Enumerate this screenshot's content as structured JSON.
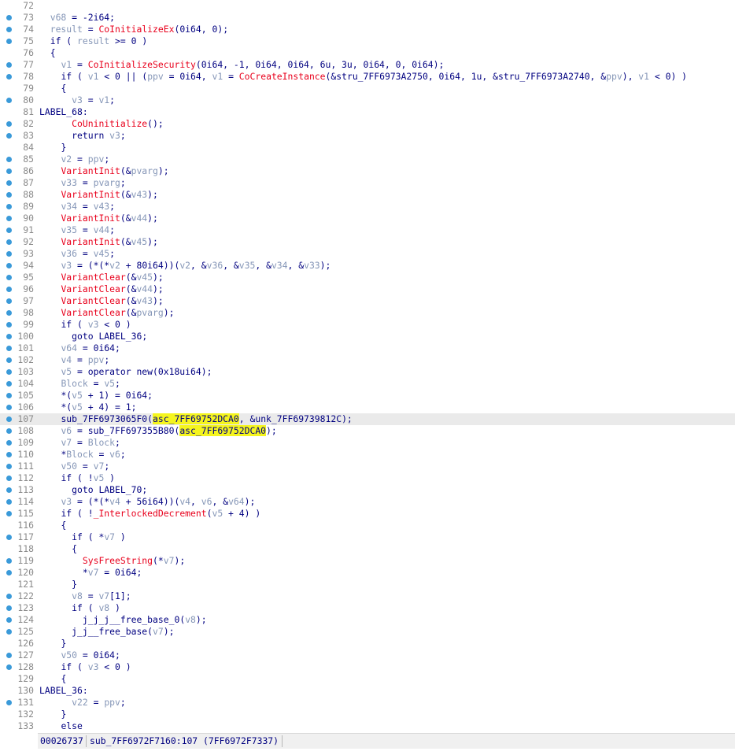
{
  "lines": [
    {
      "n": "72",
      "d": false,
      "i": "",
      "t": []
    },
    {
      "n": "73",
      "d": true,
      "i": "  ",
      "t": [
        [
          "v",
          "v68"
        ],
        [
          "p",
          " = -2i64;"
        ]
      ]
    },
    {
      "n": "74",
      "d": true,
      "i": "  ",
      "t": [
        [
          "v",
          "result"
        ],
        [
          "p",
          " = "
        ],
        [
          "f",
          "CoInitializeEx"
        ],
        [
          "p",
          "(0i64, 0);"
        ]
      ]
    },
    {
      "n": "75",
      "d": true,
      "i": "  ",
      "t": [
        [
          "k",
          "if"
        ],
        [
          "p",
          " ( "
        ],
        [
          "v",
          "result"
        ],
        [
          "p",
          " >= 0 )"
        ]
      ]
    },
    {
      "n": "76",
      "d": false,
      "i": "  ",
      "t": [
        [
          "p",
          "{"
        ]
      ]
    },
    {
      "n": "77",
      "d": true,
      "i": "    ",
      "t": [
        [
          "v",
          "v1"
        ],
        [
          "p",
          " = "
        ],
        [
          "f",
          "CoInitializeSecurity"
        ],
        [
          "p",
          "(0i64, -1, 0i64, 0i64, 6u, 3u, 0i64, 0, 0i64);"
        ]
      ]
    },
    {
      "n": "78",
      "d": true,
      "i": "    ",
      "t": [
        [
          "k",
          "if"
        ],
        [
          "p",
          " ( "
        ],
        [
          "v",
          "v1"
        ],
        [
          "p",
          " < 0 || ("
        ],
        [
          "v",
          "ppv"
        ],
        [
          "p",
          " = 0i64, "
        ],
        [
          "v",
          "v1"
        ],
        [
          "p",
          " = "
        ],
        [
          "f",
          "CoCreateInstance"
        ],
        [
          "p",
          "(&stru_7FF6973A2750, 0i64, 1u, &stru_7FF6973A2740, &"
        ],
        [
          "v",
          "ppv"
        ],
        [
          "p",
          "), "
        ],
        [
          "v",
          "v1"
        ],
        [
          "p",
          " < 0) )"
        ]
      ]
    },
    {
      "n": "79",
      "d": false,
      "i": "    ",
      "t": [
        [
          "p",
          "{"
        ]
      ]
    },
    {
      "n": "80",
      "d": true,
      "i": "      ",
      "t": [
        [
          "v",
          "v3"
        ],
        [
          "p",
          " = "
        ],
        [
          "v",
          "v1"
        ],
        [
          "p",
          ";"
        ]
      ]
    },
    {
      "n": "81",
      "d": false,
      "i": "",
      "t": [
        [
          "p",
          "LABEL_68:"
        ]
      ]
    },
    {
      "n": "82",
      "d": true,
      "i": "      ",
      "t": [
        [
          "f",
          "CoUninitialize"
        ],
        [
          "p",
          "();"
        ]
      ]
    },
    {
      "n": "83",
      "d": true,
      "i": "      ",
      "t": [
        [
          "k",
          "return"
        ],
        [
          "p",
          " "
        ],
        [
          "v",
          "v3"
        ],
        [
          "p",
          ";"
        ]
      ]
    },
    {
      "n": "84",
      "d": false,
      "i": "    ",
      "t": [
        [
          "p",
          "}"
        ]
      ]
    },
    {
      "n": "85",
      "d": true,
      "i": "    ",
      "t": [
        [
          "v",
          "v2"
        ],
        [
          "p",
          " = "
        ],
        [
          "v",
          "ppv"
        ],
        [
          "p",
          ";"
        ]
      ]
    },
    {
      "n": "86",
      "d": true,
      "i": "    ",
      "t": [
        [
          "f",
          "VariantInit"
        ],
        [
          "p",
          "(&"
        ],
        [
          "v",
          "pvarg"
        ],
        [
          "p",
          ");"
        ]
      ]
    },
    {
      "n": "87",
      "d": true,
      "i": "    ",
      "t": [
        [
          "v",
          "v33"
        ],
        [
          "p",
          " = "
        ],
        [
          "v",
          "pvarg"
        ],
        [
          "p",
          ";"
        ]
      ]
    },
    {
      "n": "88",
      "d": true,
      "i": "    ",
      "t": [
        [
          "f",
          "VariantInit"
        ],
        [
          "p",
          "(&"
        ],
        [
          "v",
          "v43"
        ],
        [
          "p",
          ");"
        ]
      ]
    },
    {
      "n": "89",
      "d": true,
      "i": "    ",
      "t": [
        [
          "v",
          "v34"
        ],
        [
          "p",
          " = "
        ],
        [
          "v",
          "v43"
        ],
        [
          "p",
          ";"
        ]
      ]
    },
    {
      "n": "90",
      "d": true,
      "i": "    ",
      "t": [
        [
          "f",
          "VariantInit"
        ],
        [
          "p",
          "(&"
        ],
        [
          "v",
          "v44"
        ],
        [
          "p",
          ");"
        ]
      ]
    },
    {
      "n": "91",
      "d": true,
      "i": "    ",
      "t": [
        [
          "v",
          "v35"
        ],
        [
          "p",
          " = "
        ],
        [
          "v",
          "v44"
        ],
        [
          "p",
          ";"
        ]
      ]
    },
    {
      "n": "92",
      "d": true,
      "i": "    ",
      "t": [
        [
          "f",
          "VariantInit"
        ],
        [
          "p",
          "(&"
        ],
        [
          "v",
          "v45"
        ],
        [
          "p",
          ");"
        ]
      ]
    },
    {
      "n": "93",
      "d": true,
      "i": "    ",
      "t": [
        [
          "v",
          "v36"
        ],
        [
          "p",
          " = "
        ],
        [
          "v",
          "v45"
        ],
        [
          "p",
          ";"
        ]
      ]
    },
    {
      "n": "94",
      "d": true,
      "i": "    ",
      "t": [
        [
          "v",
          "v3"
        ],
        [
          "p",
          " = (*(*"
        ],
        [
          "v",
          "v2"
        ],
        [
          "p",
          " + 80i64))("
        ],
        [
          "v",
          "v2"
        ],
        [
          "p",
          ", &"
        ],
        [
          "v",
          "v36"
        ],
        [
          "p",
          ", &"
        ],
        [
          "v",
          "v35"
        ],
        [
          "p",
          ", &"
        ],
        [
          "v",
          "v34"
        ],
        [
          "p",
          ", &"
        ],
        [
          "v",
          "v33"
        ],
        [
          "p",
          ");"
        ]
      ]
    },
    {
      "n": "95",
      "d": true,
      "i": "    ",
      "t": [
        [
          "f",
          "VariantClear"
        ],
        [
          "p",
          "(&"
        ],
        [
          "v",
          "v45"
        ],
        [
          "p",
          ");"
        ]
      ]
    },
    {
      "n": "96",
      "d": true,
      "i": "    ",
      "t": [
        [
          "f",
          "VariantClear"
        ],
        [
          "p",
          "(&"
        ],
        [
          "v",
          "v44"
        ],
        [
          "p",
          ");"
        ]
      ]
    },
    {
      "n": "97",
      "d": true,
      "i": "    ",
      "t": [
        [
          "f",
          "VariantClear"
        ],
        [
          "p",
          "(&"
        ],
        [
          "v",
          "v43"
        ],
        [
          "p",
          ");"
        ]
      ]
    },
    {
      "n": "98",
      "d": true,
      "i": "    ",
      "t": [
        [
          "f",
          "VariantClear"
        ],
        [
          "p",
          "(&"
        ],
        [
          "v",
          "pvarg"
        ],
        [
          "p",
          ");"
        ]
      ]
    },
    {
      "n": "99",
      "d": true,
      "i": "    ",
      "t": [
        [
          "k",
          "if"
        ],
        [
          "p",
          " ( "
        ],
        [
          "v",
          "v3"
        ],
        [
          "p",
          " < 0 )"
        ]
      ]
    },
    {
      "n": "100",
      "d": true,
      "i": "      ",
      "t": [
        [
          "k",
          "goto"
        ],
        [
          "p",
          " LABEL_36;"
        ]
      ]
    },
    {
      "n": "101",
      "d": true,
      "i": "    ",
      "t": [
        [
          "v",
          "v64"
        ],
        [
          "p",
          " = 0i64;"
        ]
      ]
    },
    {
      "n": "102",
      "d": true,
      "i": "    ",
      "t": [
        [
          "v",
          "v4"
        ],
        [
          "p",
          " = "
        ],
        [
          "v",
          "ppv"
        ],
        [
          "p",
          ";"
        ]
      ]
    },
    {
      "n": "103",
      "d": true,
      "i": "    ",
      "t": [
        [
          "v",
          "v5"
        ],
        [
          "p",
          " = operator new(0x18ui64);"
        ]
      ]
    },
    {
      "n": "104",
      "d": true,
      "i": "    ",
      "t": [
        [
          "v",
          "Block"
        ],
        [
          "p",
          " = "
        ],
        [
          "v",
          "v5"
        ],
        [
          "p",
          ";"
        ]
      ]
    },
    {
      "n": "105",
      "d": true,
      "i": "    ",
      "t": [
        [
          "p",
          "*("
        ],
        [
          "v",
          "v5"
        ],
        [
          "p",
          " + 1) = 0i64;"
        ]
      ]
    },
    {
      "n": "106",
      "d": true,
      "i": "    ",
      "t": [
        [
          "p",
          "*("
        ],
        [
          "v",
          "v5"
        ],
        [
          "p",
          " + 4) = 1;"
        ]
      ]
    },
    {
      "n": "107",
      "d": true,
      "i": "    ",
      "cur": true,
      "t": [
        [
          "p",
          "sub_7FF6973065F0("
        ],
        [
          "h",
          "asc_7FF69752DCA0"
        ],
        [
          "p",
          ", &unk_7FF69739812C);"
        ]
      ]
    },
    {
      "n": "108",
      "d": true,
      "i": "    ",
      "t": [
        [
          "v",
          "v6"
        ],
        [
          "p",
          " = sub_7FF697355B80("
        ],
        [
          "h",
          "asc_7FF69752DCA0"
        ],
        [
          "p",
          ");"
        ]
      ]
    },
    {
      "n": "109",
      "d": true,
      "i": "    ",
      "t": [
        [
          "v",
          "v7"
        ],
        [
          "p",
          " = "
        ],
        [
          "v",
          "Block"
        ],
        [
          "p",
          ";"
        ]
      ]
    },
    {
      "n": "110",
      "d": true,
      "i": "    ",
      "t": [
        [
          "p",
          "*"
        ],
        [
          "v",
          "Block"
        ],
        [
          "p",
          " = "
        ],
        [
          "v",
          "v6"
        ],
        [
          "p",
          ";"
        ]
      ]
    },
    {
      "n": "111",
      "d": true,
      "i": "    ",
      "t": [
        [
          "v",
          "v50"
        ],
        [
          "p",
          " = "
        ],
        [
          "v",
          "v7"
        ],
        [
          "p",
          ";"
        ]
      ]
    },
    {
      "n": "112",
      "d": true,
      "i": "    ",
      "t": [
        [
          "k",
          "if"
        ],
        [
          "p",
          " ( !"
        ],
        [
          "v",
          "v5"
        ],
        [
          "p",
          " )"
        ]
      ]
    },
    {
      "n": "113",
      "d": true,
      "i": "      ",
      "t": [
        [
          "k",
          "goto"
        ],
        [
          "p",
          " LABEL_70;"
        ]
      ]
    },
    {
      "n": "114",
      "d": true,
      "i": "    ",
      "t": [
        [
          "v",
          "v3"
        ],
        [
          "p",
          " = (*(*"
        ],
        [
          "v",
          "v4"
        ],
        [
          "p",
          " + 56i64))("
        ],
        [
          "v",
          "v4"
        ],
        [
          "p",
          ", "
        ],
        [
          "v",
          "v6"
        ],
        [
          "p",
          ", &"
        ],
        [
          "v",
          "v64"
        ],
        [
          "p",
          ");"
        ]
      ]
    },
    {
      "n": "115",
      "d": true,
      "i": "    ",
      "t": [
        [
          "k",
          "if"
        ],
        [
          "p",
          " ( !"
        ],
        [
          "f",
          "_InterlockedDecrement"
        ],
        [
          "p",
          "("
        ],
        [
          "v",
          "v5"
        ],
        [
          "p",
          " + 4) )"
        ]
      ]
    },
    {
      "n": "116",
      "d": false,
      "i": "    ",
      "t": [
        [
          "p",
          "{"
        ]
      ]
    },
    {
      "n": "117",
      "d": true,
      "i": "      ",
      "t": [
        [
          "k",
          "if"
        ],
        [
          "p",
          " ( *"
        ],
        [
          "v",
          "v7"
        ],
        [
          "p",
          " )"
        ]
      ]
    },
    {
      "n": "118",
      "d": false,
      "i": "      ",
      "t": [
        [
          "p",
          "{"
        ]
      ]
    },
    {
      "n": "119",
      "d": true,
      "i": "        ",
      "t": [
        [
          "f",
          "SysFreeString"
        ],
        [
          "p",
          "(*"
        ],
        [
          "v",
          "v7"
        ],
        [
          "p",
          ");"
        ]
      ]
    },
    {
      "n": "120",
      "d": true,
      "i": "        ",
      "t": [
        [
          "p",
          "*"
        ],
        [
          "v",
          "v7"
        ],
        [
          "p",
          " = 0i64;"
        ]
      ]
    },
    {
      "n": "121",
      "d": false,
      "i": "      ",
      "t": [
        [
          "p",
          "}"
        ]
      ]
    },
    {
      "n": "122",
      "d": true,
      "i": "      ",
      "t": [
        [
          "v",
          "v8"
        ],
        [
          "p",
          " = "
        ],
        [
          "v",
          "v7"
        ],
        [
          "p",
          "[1];"
        ]
      ]
    },
    {
      "n": "123",
      "d": true,
      "i": "      ",
      "t": [
        [
          "k",
          "if"
        ],
        [
          "p",
          " ( "
        ],
        [
          "v",
          "v8"
        ],
        [
          "p",
          " )"
        ]
      ]
    },
    {
      "n": "124",
      "d": true,
      "i": "        ",
      "t": [
        [
          "p",
          "j_j_j__free_base_0("
        ],
        [
          "v",
          "v8"
        ],
        [
          "p",
          ");"
        ]
      ]
    },
    {
      "n": "125",
      "d": true,
      "i": "      ",
      "t": [
        [
          "p",
          "j_j__free_base("
        ],
        [
          "v",
          "v7"
        ],
        [
          "p",
          ");"
        ]
      ]
    },
    {
      "n": "126",
      "d": false,
      "i": "    ",
      "t": [
        [
          "p",
          "}"
        ]
      ]
    },
    {
      "n": "127",
      "d": true,
      "i": "    ",
      "t": [
        [
          "v",
          "v50"
        ],
        [
          "p",
          " = 0i64;"
        ]
      ]
    },
    {
      "n": "128",
      "d": true,
      "i": "    ",
      "t": [
        [
          "k",
          "if"
        ],
        [
          "p",
          " ( "
        ],
        [
          "v",
          "v3"
        ],
        [
          "p",
          " < 0 )"
        ]
      ]
    },
    {
      "n": "129",
      "d": false,
      "i": "    ",
      "t": [
        [
          "p",
          "{"
        ]
      ]
    },
    {
      "n": "130",
      "d": false,
      "i": "",
      "t": [
        [
          "p",
          "LABEL_36:"
        ]
      ]
    },
    {
      "n": "131",
      "d": true,
      "i": "      ",
      "t": [
        [
          "v",
          "v22"
        ],
        [
          "p",
          " = "
        ],
        [
          "v",
          "ppv"
        ],
        [
          "p",
          ";"
        ]
      ]
    },
    {
      "n": "132",
      "d": false,
      "i": "    ",
      "t": [
        [
          "p",
          "}"
        ]
      ]
    },
    {
      "n": "133",
      "d": false,
      "i": "    ",
      "t": [
        [
          "k",
          "else"
        ]
      ]
    }
  ],
  "status": {
    "offset": "00026737",
    "location": "sub_7FF6972F7160:107 (7FF6972F7337)"
  },
  "colors": {
    "keyword": "#000080",
    "variable": "#8596b7",
    "function": "#e8001c",
    "highlight": "#f5f51e",
    "breakpoint_dot": "#3a9ad9"
  }
}
